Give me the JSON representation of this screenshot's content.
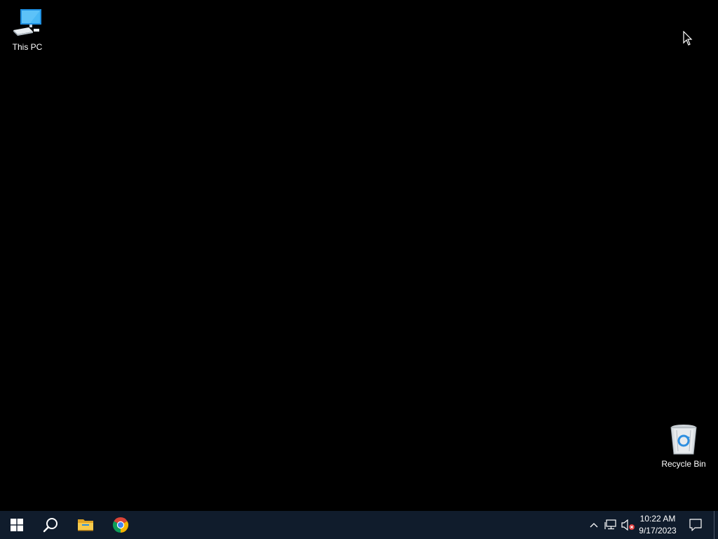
{
  "desktop": {
    "icons": [
      {
        "label": "This PC",
        "icon": "computer-monitor-icon"
      },
      {
        "label": "Recycle Bin",
        "icon": "recycle-bin-icon"
      }
    ],
    "background_color": "#000000"
  },
  "taskbar": {
    "background_color": "#101c2c",
    "pinned": [
      {
        "icon": "windows-start-icon"
      },
      {
        "icon": "search-icon"
      },
      {
        "icon": "file-explorer-icon"
      },
      {
        "icon": "chrome-icon"
      }
    ],
    "tray": {
      "icons": [
        "chevron-up-icon",
        "network-icon",
        "volume-muted-icon"
      ],
      "time": "10:22 AM",
      "date": "9/17/2023",
      "notification_icon": "action-center-icon"
    }
  },
  "colors": {
    "accent_blue": "#3aa0e8",
    "folder_yellow": "#f4c23a",
    "mute_red": "#e03c3c"
  }
}
